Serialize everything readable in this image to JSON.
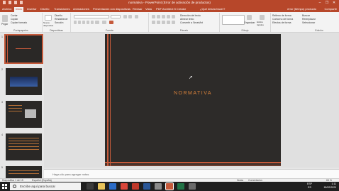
{
  "window": {
    "title": "normativa - PowerPoint (Error de activación de productos)",
    "controls": [
      "–",
      "❐",
      "✕"
    ]
  },
  "menu": {
    "tabs": [
      "Archivo",
      "Inicio",
      "Insertar",
      "Diseño",
      "Transiciones",
      "Animaciones",
      "Presentación con diapositivas",
      "Revisar",
      "Vista",
      "PDF Architect 5 Creator",
      "¿Qué desea hacer?"
    ],
    "active_tab": "Inicio",
    "account": "error (tiempo) producto",
    "share": "Compartir"
  },
  "ribbon": {
    "groups": [
      "Portapapeles",
      "Diapositivas",
      "Fuente",
      "Párrafo",
      "Dibujo",
      "Edición"
    ],
    "paste": "Pegar",
    "cut": "Cortar",
    "copy": "Copiar",
    "format_painter": "Copiar formato",
    "new_slide": "Nueva diapositiva",
    "layout": "Diseño",
    "reset": "Restablecer",
    "section": "Sección",
    "text_direction": "Dirección del texto",
    "align_text": "Alinear texto",
    "smartart": "Convertir a SmartArt",
    "arrange": "Organizar",
    "quick_styles": "Estilos rápidos",
    "shape_fill": "Relleno de forma",
    "shape_outline": "Contorno de forma",
    "shape_effects": "Efectos de forma",
    "find": "Buscar",
    "replace": "Reemplazar",
    "select": "Seleccionar"
  },
  "slides": [
    {
      "num": "1"
    },
    {
      "num": "2"
    },
    {
      "num": "3"
    },
    {
      "num": "4"
    },
    {
      "num": "5"
    }
  ],
  "slide": {
    "title": "NORMATIVA"
  },
  "notes": {
    "placeholder": "Haga clic para agregar notas"
  },
  "status": {
    "slide_count": "Diapositiva 1 de 15",
    "language": "Español (España)",
    "notes": "Notas",
    "comments": "Comentarios",
    "zoom": "65 %"
  },
  "taskbar": {
    "search_placeholder": "Escribe aquí para buscar",
    "lang_top": "ESP",
    "lang_bottom": "ES",
    "time": "1:11",
    "date": "18/02/2020"
  },
  "colors": {
    "accent": "#b7472a",
    "slide_bg": "#2d2b29",
    "slide_orange": "#c55a3b"
  }
}
